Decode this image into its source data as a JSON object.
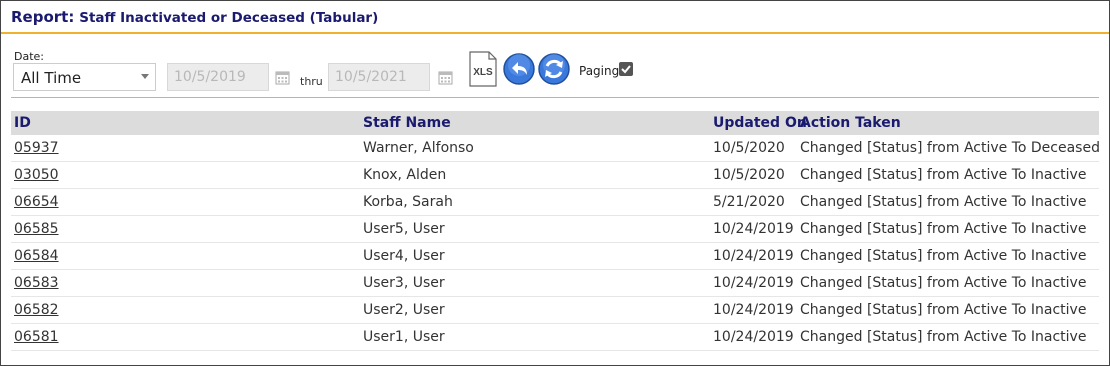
{
  "report": {
    "title_lead": "Report:",
    "title_rest": "Staff Inactivated or Deceased (Tabular)"
  },
  "filter": {
    "date_label": "Date:",
    "range_selected": "All Time",
    "from_date": "10/5/2019",
    "thru_label": "thru",
    "to_date": "10/5/2021",
    "xls_label": "XLS",
    "paging_label": "Paging",
    "paging_checked": true
  },
  "table": {
    "headers": {
      "id": "ID",
      "name": "Staff Name",
      "updated": "Updated On",
      "action": "Action Taken"
    },
    "rows": [
      {
        "id": "05937",
        "name": "Warner, Alfonso",
        "updated": "10/5/2020",
        "action": "Changed [Status] from Active To Deceased"
      },
      {
        "id": "03050",
        "name": "Knox, Alden",
        "updated": "10/5/2020",
        "action": "Changed [Status] from Active To Inactive"
      },
      {
        "id": "06654",
        "name": "Korba, Sarah",
        "updated": "5/21/2020",
        "action": "Changed [Status] from Active To Inactive"
      },
      {
        "id": "06585",
        "name": "User5, User",
        "updated": "10/24/2019",
        "action": "Changed [Status] from Active To Inactive"
      },
      {
        "id": "06584",
        "name": "User4, User",
        "updated": "10/24/2019",
        "action": "Changed [Status] from Active To Inactive"
      },
      {
        "id": "06583",
        "name": "User3, User",
        "updated": "10/24/2019",
        "action": "Changed [Status] from Active To Inactive"
      },
      {
        "id": "06582",
        "name": "User2, User",
        "updated": "10/24/2019",
        "action": "Changed [Status] from Active To Inactive"
      },
      {
        "id": "06581",
        "name": "User1, User",
        "updated": "10/24/2019",
        "action": "Changed [Status] from Active To Inactive"
      }
    ]
  },
  "colors": {
    "accent": "#f0b030",
    "title": "#1a1a6e",
    "button_blue": "#2f6fd8",
    "header_bg": "#dcdcdc"
  }
}
